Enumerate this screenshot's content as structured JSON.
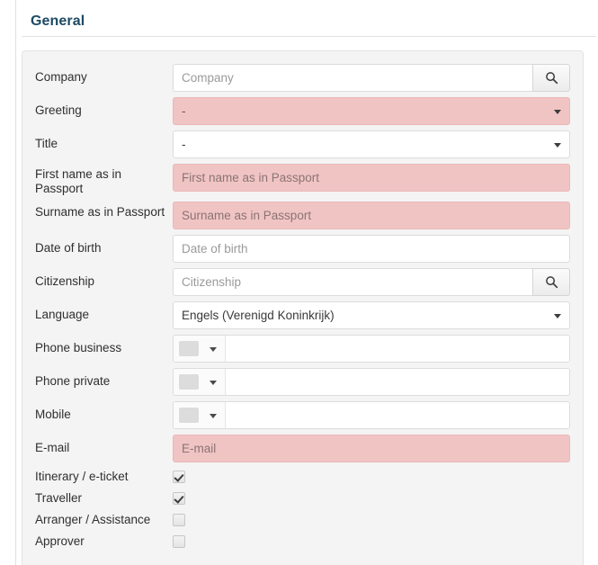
{
  "section": {
    "title": "General"
  },
  "fields": {
    "company": {
      "label": "Company",
      "placeholder": "Company",
      "value": "",
      "search_icon": "search-icon"
    },
    "greeting": {
      "label": "Greeting",
      "value": "-",
      "required": true
    },
    "title": {
      "label": "Title",
      "value": "-",
      "required": false
    },
    "first_name": {
      "label": "First name as in Passport",
      "placeholder": "First name as in Passport",
      "value": "",
      "required": true
    },
    "surname": {
      "label": "Surname as in Passport",
      "placeholder": "Surname as in Passport",
      "value": "",
      "required": true
    },
    "date_of_birth": {
      "label": "Date of birth",
      "placeholder": "Date of birth",
      "value": ""
    },
    "citizenship": {
      "label": "Citizenship",
      "placeholder": "Citizenship",
      "value": "",
      "search_icon": "search-icon"
    },
    "language": {
      "label": "Language",
      "value": "Engels (Verenigd Koninkrijk)"
    },
    "phone_business": {
      "label": "Phone business",
      "prefix_value": "",
      "value": ""
    },
    "phone_private": {
      "label": "Phone private",
      "prefix_value": "",
      "value": ""
    },
    "mobile": {
      "label": "Mobile",
      "prefix_value": "",
      "value": ""
    },
    "email": {
      "label": "E-mail",
      "placeholder": "E-mail",
      "value": "",
      "required": true
    }
  },
  "checkboxes": [
    {
      "label": "Itinerary / e-ticket",
      "checked": true
    },
    {
      "label": "Traveller",
      "checked": true
    },
    {
      "label": "Arranger / Assistance",
      "checked": false
    },
    {
      "label": "Approver",
      "checked": false
    }
  ],
  "colors": {
    "heading": "#1c4a63",
    "panel_bg": "#f4f4f4",
    "required_field_bg": "#f1c4c4",
    "input_border": "#dcdcdc",
    "page_bg": "#ffffff"
  }
}
